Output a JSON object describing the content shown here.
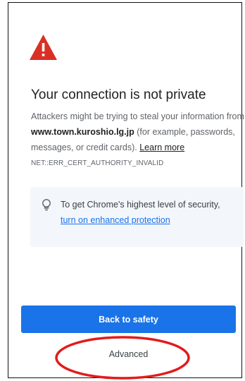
{
  "interstitial": {
    "title": "Your connection is not private",
    "description_lead": "Attackers might be trying to steal your information from",
    "domain": "www.town.kuroshio.lg.jp",
    "description_tail": " (for example, passwords, messages, or credit cards). ",
    "learn_more": "Learn more",
    "error_code": "NET::ERR_CERT_AUTHORITY_INVALID"
  },
  "security_card": {
    "text": "To get Chrome's highest level of security, ",
    "link": "turn on enhanced protection"
  },
  "actions": {
    "back_to_safety": "Back to safety",
    "advanced": "Advanced"
  },
  "icons": {
    "warning": "warning-triangle-icon",
    "bulb": "lightbulb-icon"
  },
  "colors": {
    "warning_red": "#d93025",
    "primary_blue": "#1a73e8",
    "card_background": "#f3f6fb",
    "annotation_red": "#e31b1b"
  }
}
